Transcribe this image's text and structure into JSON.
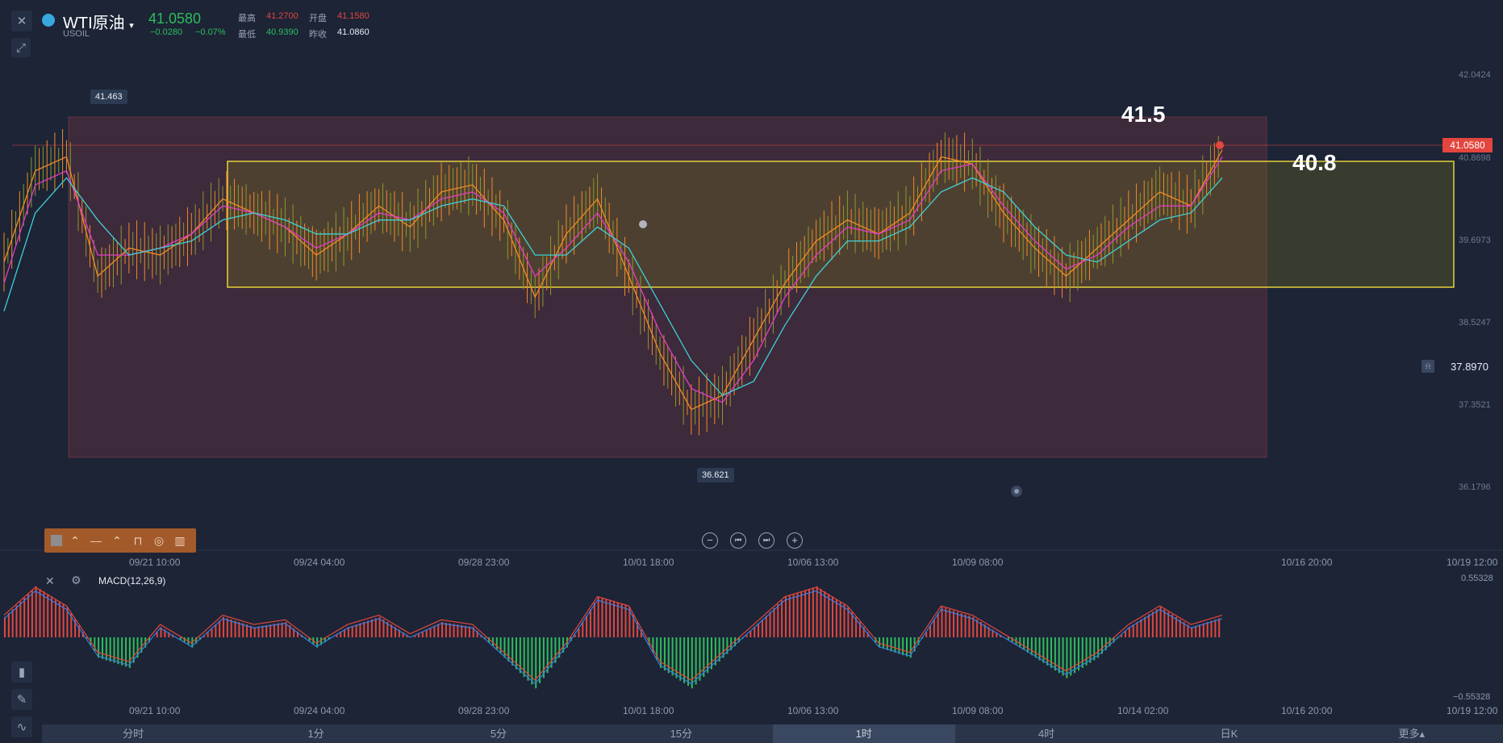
{
  "header": {
    "symbol_name": "WTI原油",
    "symbol_code": "USOIL",
    "last_price": "41.0580",
    "change": "−0.0280",
    "change_pct": "−0.07%",
    "high_label": "最高",
    "high_value": "41.2700",
    "open_label": "开盘",
    "open_value": "41.1580",
    "low_label": "最低",
    "low_value": "40.9390",
    "prev_close_label": "昨收",
    "prev_close_value": "41.0860"
  },
  "price_axis": [
    "42.0424",
    "40.8698",
    "39.6973",
    "38.5247",
    "37.3521",
    "36.1796"
  ],
  "price_badge": "41.0580",
  "alert_price": "37.8970",
  "tooltips": {
    "high": "41.463",
    "low": "36.621"
  },
  "annotations": {
    "top": "41.5",
    "bottom": "40.8"
  },
  "time_axis_main": [
    "09/21 10:00",
    "09/24 04:00",
    "09/28 23:00",
    "10/01 18:00",
    "10/06 13:00",
    "10/09 08:00",
    "10/16 20:00",
    "10/19 12:00"
  ],
  "time_axis_macd": [
    "09/21 10:00",
    "09/24 04:00",
    "09/28 23:00",
    "10/01 18:00",
    "10/06 13:00",
    "10/09 08:00",
    "10/14 02:00",
    "10/16 20:00",
    "10/19 12:00"
  ],
  "macd": {
    "label": "MACD(12,26,9)",
    "top": "0.55328",
    "bottom": "−0.55328"
  },
  "tabs": [
    "分时",
    "1分",
    "5分",
    "15分",
    "1时",
    "4时",
    "日K",
    "更多▴"
  ],
  "active_tab": "1时",
  "colors": {
    "up": "#e2463e",
    "down": "#2dbd5a",
    "ma1": "#f08a24",
    "ma2": "#e23cc8",
    "ma3": "#3fd0d6",
    "box_outer": "rgba(130,60,70,0.35)",
    "box_inner": "rgba(120,110,30,0.35)"
  },
  "chart_data": {
    "type": "line",
    "title": "WTI原油 USOIL 1时",
    "x": [
      "09/21 10:00",
      "09/24 04:00",
      "09/28 23:00",
      "10/01 18:00",
      "10/06 13:00",
      "10/09 08:00",
      "10/14 02:00",
      "10/16 20:00",
      "10/19 12:00"
    ],
    "ylim": [
      36.1796,
      42.0424
    ],
    "series": [
      {
        "values": [
          39.4,
          40.7,
          40.9,
          39.2,
          39.6,
          39.5,
          39.8,
          40.3,
          40.1,
          39.9,
          39.5,
          39.8,
          40.2,
          39.9,
          40.4,
          40.5,
          40.0,
          38.9,
          39.8,
          40.3,
          39.2,
          38.1,
          37.3,
          37.5,
          38.3,
          39.1,
          39.7,
          40.0,
          39.8,
          40.1,
          40.9,
          40.8,
          40.1,
          39.6,
          39.2,
          39.6,
          40.0,
          40.4,
          40.2,
          41.0
        ]
      },
      {
        "values": [
          39.1,
          40.5,
          40.7,
          39.5,
          39.5,
          39.6,
          39.8,
          40.2,
          40.1,
          39.9,
          39.6,
          39.8,
          40.1,
          40.0,
          40.3,
          40.4,
          40.1,
          39.2,
          39.6,
          40.1,
          39.4,
          38.4,
          37.6,
          37.4,
          38.0,
          38.9,
          39.5,
          39.9,
          39.8,
          40.0,
          40.7,
          40.8,
          40.2,
          39.7,
          39.3,
          39.5,
          39.9,
          40.2,
          40.2,
          40.9
        ]
      },
      {
        "values": [
          38.7,
          40.1,
          40.6,
          40.0,
          39.5,
          39.6,
          39.7,
          40.0,
          40.1,
          40.0,
          39.8,
          39.8,
          40.0,
          40.0,
          40.2,
          40.3,
          40.2,
          39.5,
          39.5,
          39.9,
          39.6,
          38.8,
          38.0,
          37.5,
          37.7,
          38.5,
          39.2,
          39.7,
          39.7,
          39.9,
          40.4,
          40.6,
          40.4,
          39.9,
          39.5,
          39.4,
          39.7,
          40.0,
          40.1,
          40.6
        ]
      }
    ],
    "macd_values": [
      0.2,
      0.5,
      0.3,
      -0.2,
      -0.3,
      0.1,
      -0.1,
      0.2,
      0.1,
      0.15,
      -0.1,
      0.1,
      0.2,
      0.0,
      0.15,
      0.1,
      -0.2,
      -0.5,
      -0.1,
      0.4,
      0.3,
      -0.3,
      -0.5,
      -0.2,
      0.1,
      0.4,
      0.5,
      0.3,
      -0.1,
      -0.2,
      0.3,
      0.2,
      0.0,
      -0.2,
      -0.4,
      -0.2,
      0.1,
      0.3,
      0.1,
      0.2
    ]
  }
}
